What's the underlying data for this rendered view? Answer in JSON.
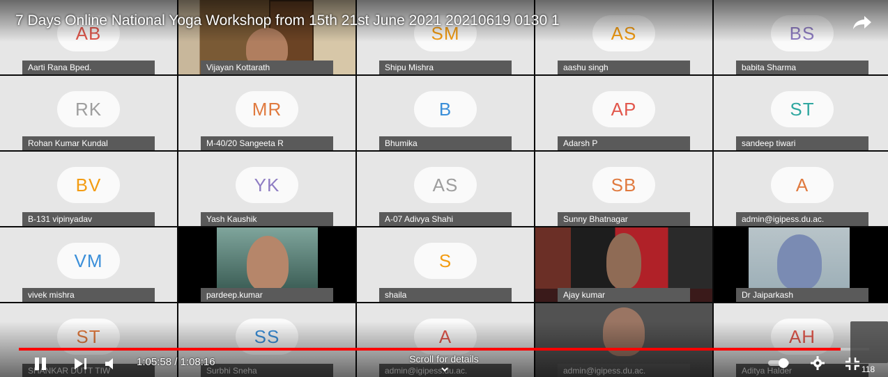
{
  "video_title": "7 Days Online National Yoga Workshop from 15th 21st June 2021 20210619 0130 1",
  "tiles": [
    {
      "name": "Aarti Rana Bped.",
      "initials": "AB",
      "color": "#e2574c"
    },
    {
      "name": "Vijayan Kottarath",
      "initials": "",
      "video": "room"
    },
    {
      "name": "Shipu Mishra",
      "initials": "SM",
      "color": "#f39c12"
    },
    {
      "name": "aashu singh",
      "initials": "AS",
      "color": "#f39c12"
    },
    {
      "name": "babita Sharma",
      "initials": "BS",
      "color": "#8e7cc3"
    },
    {
      "name": "Rohan Kumar Kundal",
      "initials": "RK",
      "color": "#9e9e9e"
    },
    {
      "name": "M-40/20 Sangeeta R",
      "initials": "MR",
      "color": "#e07a3f"
    },
    {
      "name": "Bhumika",
      "initials": "B",
      "color": "#3b8fd9"
    },
    {
      "name": "Adarsh P",
      "initials": "AP",
      "color": "#e2574c"
    },
    {
      "name": "sandeep tiwari",
      "initials": "ST",
      "color": "#2fa7a0"
    },
    {
      "name": "B-131 vipinyadav",
      "initials": "BV",
      "color": "#f39c12"
    },
    {
      "name": "Yash Kaushik",
      "initials": "YK",
      "color": "#8e7cc3"
    },
    {
      "name": "A-07 Adivya Shahi",
      "initials": "AS",
      "color": "#9e9e9e"
    },
    {
      "name": "Sunny Bhatnagar",
      "initials": "SB",
      "color": "#e07a3f"
    },
    {
      "name": "admin@igipess.du.ac.",
      "initials": "A",
      "color": "#e07a3f"
    },
    {
      "name": "vivek mishra",
      "initials": "VM",
      "color": "#3b8fd9"
    },
    {
      "name": "pardeep.kumar",
      "initials": "",
      "video": "green"
    },
    {
      "name": "shaila",
      "initials": "S",
      "color": "#f39c12"
    },
    {
      "name": "Ajay kumar",
      "initials": "",
      "video": "red"
    },
    {
      "name": "Dr Jaiparkash",
      "initials": "",
      "video": "blue"
    },
    {
      "name": "SHANKAR DUTT TIW",
      "initials": "ST",
      "color": "#e07a3f"
    },
    {
      "name": "Surbhi Sneha",
      "initials": "SS",
      "color": "#3b8fd9"
    },
    {
      "name": "admin@igipess.du.ac.",
      "initials": "A",
      "color": "#e2574c"
    },
    {
      "name": "admin@igipess.du.ac.",
      "initials": "",
      "video": "dark"
    },
    {
      "name": "Aditya Halder",
      "initials": "AH",
      "color": "#e2574c"
    }
  ],
  "player": {
    "time_current": "1:05:58",
    "time_separator": " / ",
    "time_total": "1:08:16",
    "progress": 0.966,
    "scroll_hint": "Scroll for details",
    "participant_count": "118"
  },
  "icons": [
    "share-icon",
    "pause-icon",
    "next-icon",
    "volume-icon",
    "autoplay-toggle-icon",
    "settings-gear-icon",
    "exit-fullscreen-icon",
    "chevron-down-icon"
  ]
}
